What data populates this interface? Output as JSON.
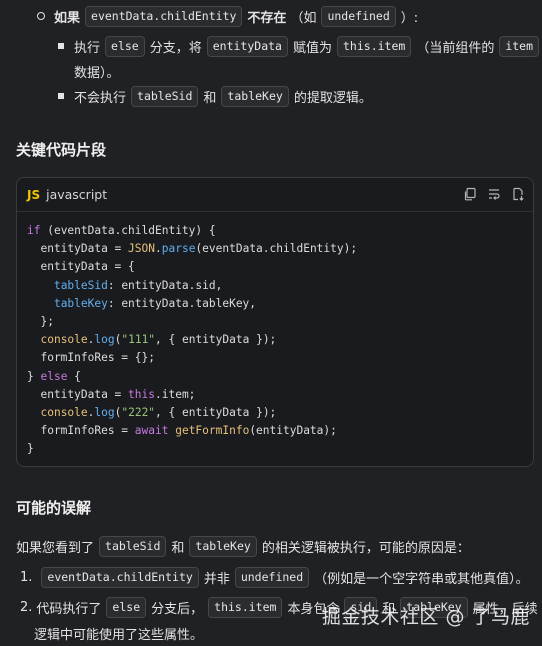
{
  "list1": {
    "item_if": {
      "b1": "如果",
      "c1": "eventData.childEntity",
      "b2": "不存在",
      "t1": "（如",
      "c2": "undefined",
      "t2": "）:"
    },
    "sub1": {
      "t1": "执行",
      "c1": "else",
      "t2": "分支，将",
      "c2": "entityData",
      "t3": "赋值为",
      "c3": "this.item",
      "t4": "（当前组件的",
      "c4": "item",
      "t5": "数据）。"
    },
    "sub2": {
      "t1": "不会执行",
      "c1": "tableSid",
      "t2": "和",
      "c2": "tableKey",
      "t3": "的提取逻辑。"
    }
  },
  "section1": {
    "title": "关键代码片段"
  },
  "code": {
    "badge": "JS",
    "lang": "javascript",
    "icons": [
      "copy-icon",
      "wrap-icon",
      "download-icon"
    ]
  },
  "section2": {
    "title": "可能的误解"
  },
  "para": {
    "t1": "如果您看到了",
    "c1": "tableSid",
    "t2": "和",
    "c2": "tableKey",
    "t3": "的相关逻辑被执行，可能的原因是："
  },
  "ol": {
    "n1": "1.",
    "i1": {
      "c1": "eventData.childEntity",
      "t1": "并非",
      "c2": "undefined",
      "t2": "（例如是一个空字符串或其他真值）。"
    },
    "n2": "2.",
    "i2": {
      "t1": "代码执行了",
      "c1": "else",
      "t2": "分支后，",
      "c2": "this.item",
      "t3": "本身包含",
      "c3": "sid",
      "t4": "和",
      "c4": "tableKey",
      "t5": "属性，后续",
      "t6": "逻辑中可能使用了这些属性。"
    }
  },
  "watermark": "掘金技术社区 @ 了马鹿"
}
